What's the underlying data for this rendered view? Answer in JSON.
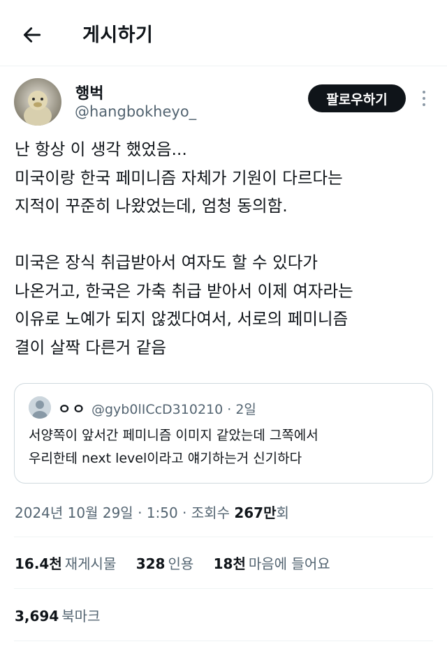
{
  "header": {
    "title": "게시하기"
  },
  "author": {
    "display_name": "행벅",
    "handle": "@hangbokheyo_",
    "follow_label": "팔로우하기"
  },
  "tweet": {
    "lines": [
      "난 항상 이 생각 했었음...",
      "미국이랑 한국 페미니즘 자체가 기원이 다르다는",
      "지적이 꾸준히 나왔었는데, 엄청 동의함.",
      "",
      "미국은 장식 취급받아서 여자도 할 수 있다가",
      "나온거고, 한국은 가축 취급 받아서 이제 여자라는",
      "이유로 노예가 되지 않겠다여서, 서로의 페미니즘",
      "결이 살짝 다른거 같음"
    ]
  },
  "quote": {
    "name": "ㅇㅇ",
    "handle_time": "@gyb0lICcD310210 · 2일",
    "lines": [
      "서양쪽이 앞서간 페미니즘 이미지 같았는데 그쪽에서",
      "우리한테 next level이라고 얘기하는거 신기하다"
    ]
  },
  "meta": {
    "timestamp": "2024년 10월 29일 · 1:50 · 조회수 ",
    "views_number": "267만",
    "views_suffix": "회"
  },
  "stats": {
    "reposts_count": "16.4천",
    "reposts_label": "재게시물",
    "quotes_count": "328",
    "quotes_label": "인용",
    "likes_count": "18천",
    "likes_label": "마음에 들어요"
  },
  "bookmarks": {
    "count": "3,694",
    "label": "북마크"
  },
  "colors": {
    "text": "#0f1419",
    "secondary": "#536471",
    "border": "#cfd9de",
    "divider": "#eff3f4",
    "follow_bg": "#0f1419"
  },
  "icons": {
    "back": "arrow-left-icon",
    "more": "more-vertical-icon",
    "avatar": "duck-photo-avatar",
    "quote_avatar": "default-user-avatar"
  }
}
